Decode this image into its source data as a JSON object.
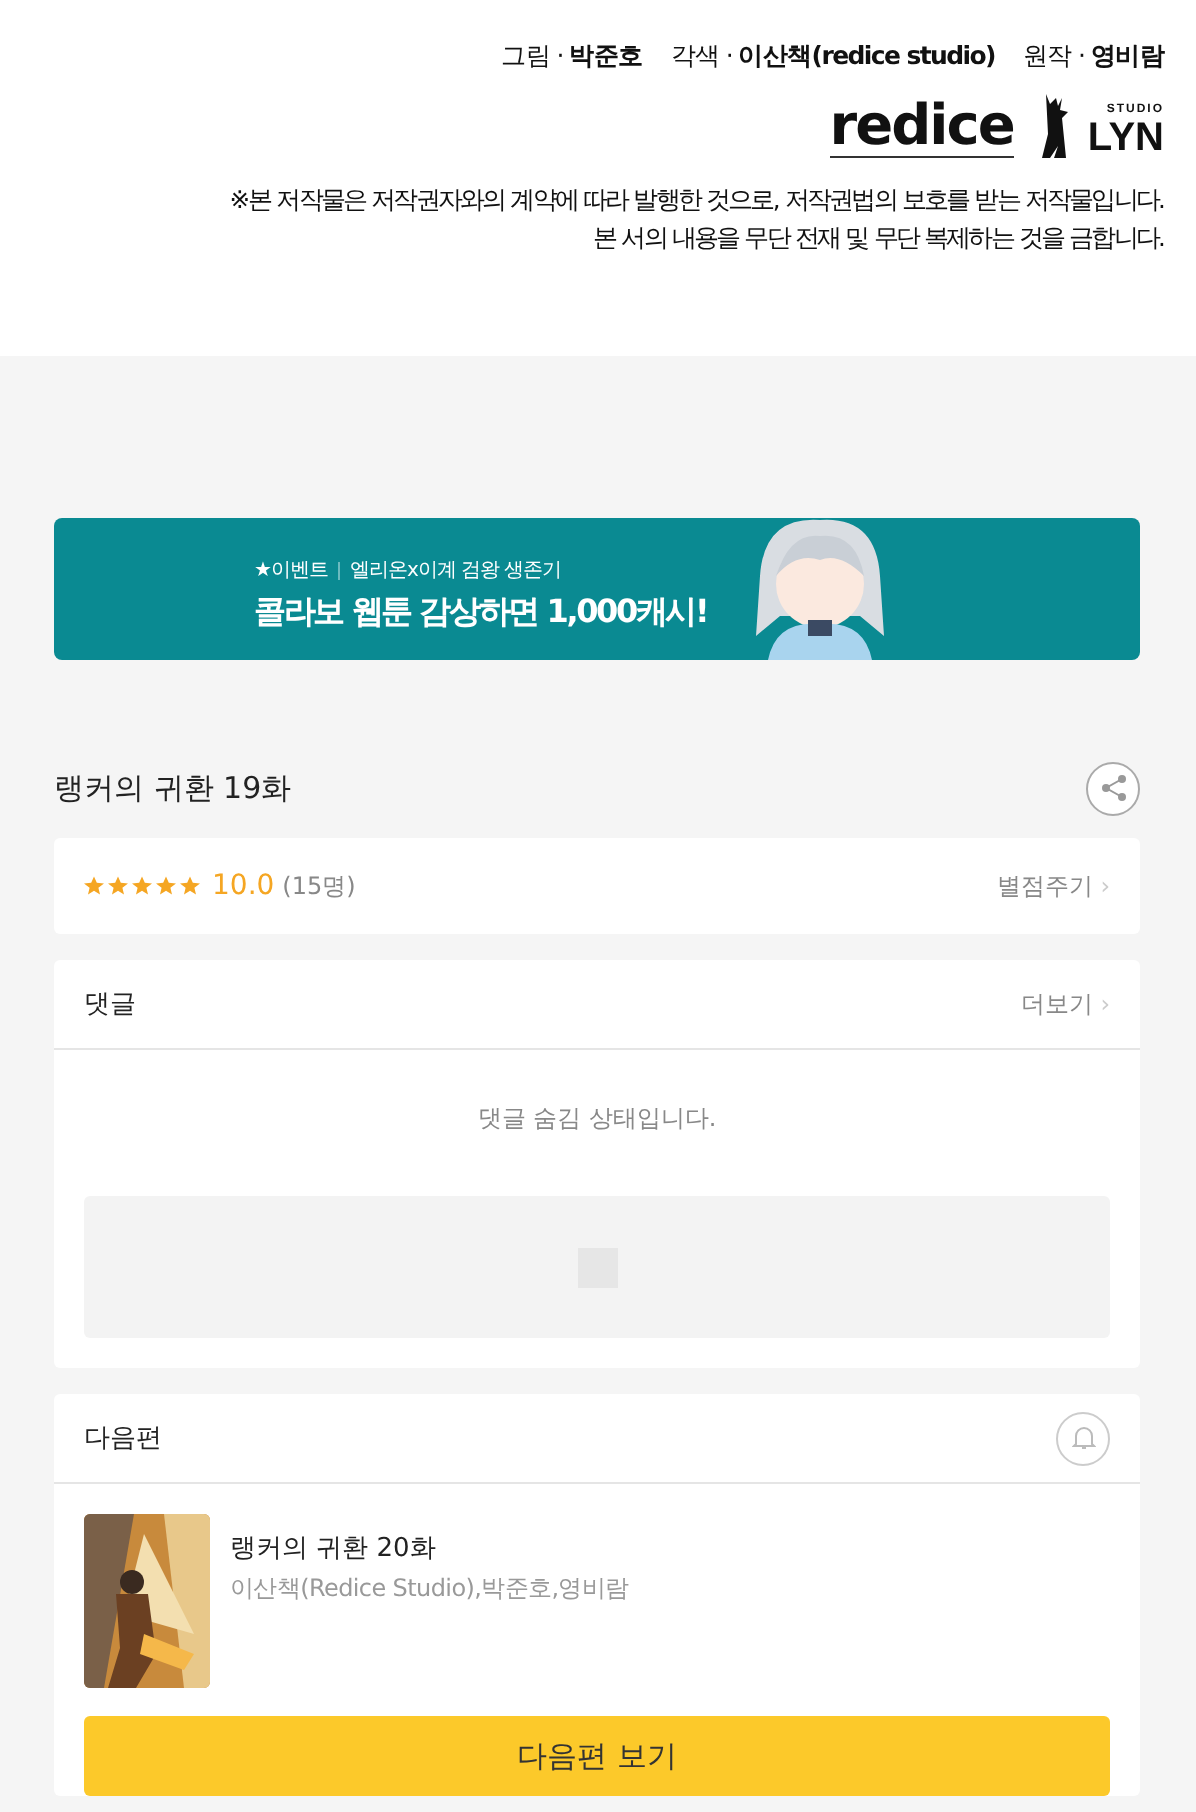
{
  "credits": {
    "items": [
      {
        "role": "그림",
        "sep": "·",
        "name": "박준호"
      },
      {
        "role": "각색",
        "sep": "·",
        "name": "이산책(redice studio)"
      },
      {
        "role": "원작",
        "sep": "·",
        "name": "영비람"
      }
    ],
    "logos": [
      {
        "kind": "redice",
        "text": "redice"
      },
      {
        "kind": "lyn",
        "small": "STUDIO",
        "text": "LYN"
      }
    ],
    "notice": [
      "※본 저작물은 저작권자와의 계약에 따라 발행한 것으로, 저작권법의 보호를 받는 저작물입니다.",
      "본 서의 내용을 무단 전재 및 무단 복제하는 것을 금합니다."
    ]
  },
  "banner": {
    "tag": "★이벤트",
    "subtitle": "엘리온x이계 검왕 생존기",
    "headline": "콜라보 웹툰 감상하면 1,000캐시!"
  },
  "episode_title": "랭커의 귀환 19화",
  "rating": {
    "stars": 5,
    "score": "10.0",
    "count": "(15명)",
    "action": "별점주기",
    "chevron": "›"
  },
  "comments": {
    "title": "댓글",
    "more": "더보기",
    "chevron": "›",
    "message": "댓글 숨김 상태입니다."
  },
  "next": {
    "title": "다음편",
    "episode": "랭커의 귀환 20화",
    "authors": "이산책(Redice Studio),박준호,영비람",
    "button": "다음편 보기"
  }
}
